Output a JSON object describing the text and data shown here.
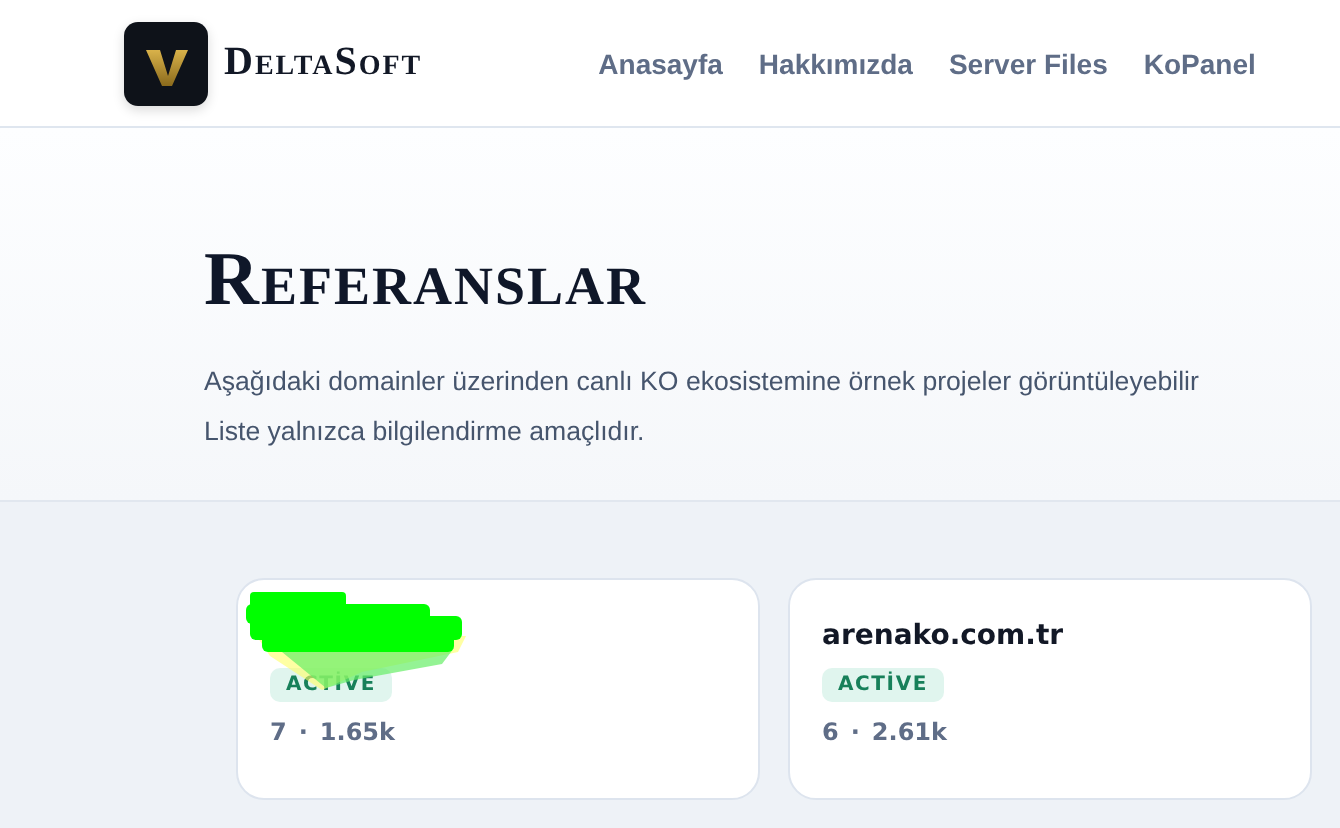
{
  "header": {
    "brand": "DeltaSoft",
    "nav": [
      {
        "label": "Anasayfa"
      },
      {
        "label": "Hakkımızda"
      },
      {
        "label": "Server Files"
      },
      {
        "label": "KoPanel"
      }
    ]
  },
  "hero": {
    "title": "Referanslar",
    "lines": [
      "Aşağıdaki domainler üzerinden canlı KO ekosistemine örnek projeler görüntüleyebilir",
      "Liste yalnızca bilgilendirme amaçlıdır."
    ]
  },
  "cards": [
    {
      "redacted": true,
      "badge": "ACTİVE",
      "count": "7",
      "separator": "·",
      "views": "1.65k"
    },
    {
      "redacted": false,
      "title": "arenako.com.tr",
      "badge": "ACTİVE",
      "count": "6",
      "separator": "·",
      "views": "2.61k"
    }
  ]
}
